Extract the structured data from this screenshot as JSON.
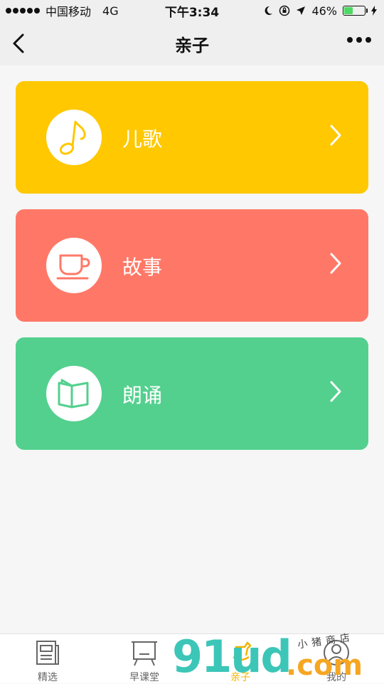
{
  "status_bar": {
    "carrier": "中国移动",
    "network": "4G",
    "time": "下午3:34",
    "battery_percent": "46%",
    "battery_level": 0.46,
    "battery_color": "#4cd964"
  },
  "nav": {
    "title": "亲子",
    "back_icon": "chevron-left-icon",
    "more_icon": "more-dots-icon"
  },
  "cards": [
    {
      "label": "儿歌",
      "icon": "music-note-icon",
      "color": "#ffc800"
    },
    {
      "label": "故事",
      "icon": "coffee-cup-icon",
      "color": "#ff7867"
    },
    {
      "label": "朗诵",
      "icon": "open-book-icon",
      "color": "#53d08e"
    }
  ],
  "tabs": [
    {
      "label": "精选",
      "icon": "newspaper-icon",
      "active": false
    },
    {
      "label": "早课堂",
      "icon": "chalkboard-icon",
      "active": false
    },
    {
      "label": "亲子",
      "icon": "rocking-horse-icon",
      "active": true
    },
    {
      "label": "我的",
      "icon": "user-icon",
      "active": false
    }
  ],
  "watermark": {
    "main": "91ud",
    "suffix": ".com",
    "sub": "小猪商店"
  }
}
